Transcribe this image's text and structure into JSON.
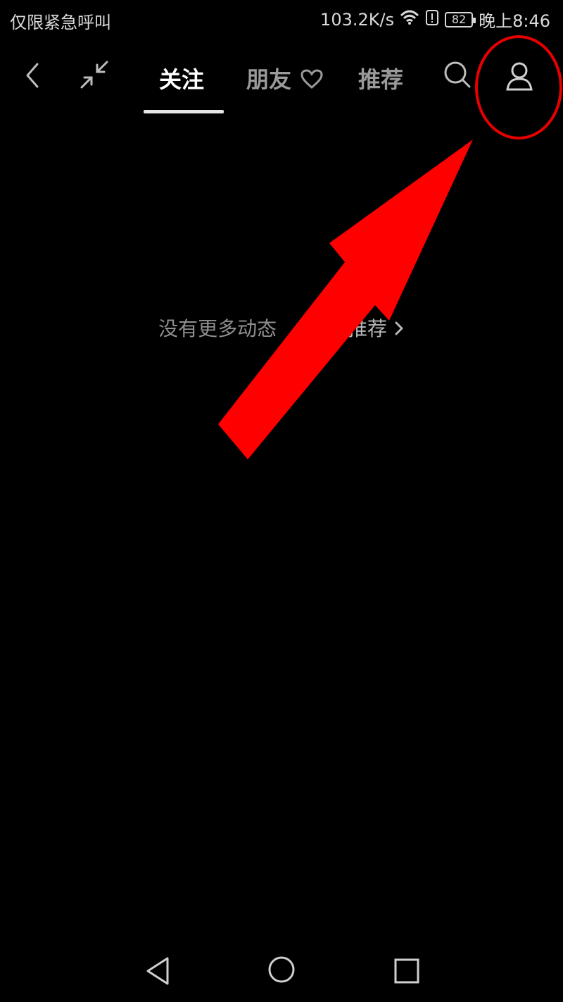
{
  "status_bar": {
    "carrier_text": "仅限紧急呼叫",
    "net_speed": "103.2K/s",
    "battery_level": "82",
    "time": "晚上8:46",
    "icons": [
      "wifi-icon",
      "alert-sim-icon",
      "battery-icon"
    ]
  },
  "top_nav": {
    "tabs": [
      {
        "label": "关注",
        "active": true
      },
      {
        "label": "朋友",
        "active": false
      },
      {
        "label": "推荐",
        "active": false
      }
    ],
    "icons": [
      "back-icon",
      "collapse-icon",
      "heart-icon",
      "search-icon",
      "profile-icon"
    ]
  },
  "empty_state": {
    "message": "没有更多动态",
    "link_text": "推荐",
    "link_icon": "chevron-right-icon"
  },
  "annotations": {
    "highlight_color": "#e60000",
    "arrow_color": "#ff0000",
    "highlight_target": "profile-icon"
  },
  "bottom_nav": {
    "icons": [
      "nav-back-icon",
      "nav-home-icon",
      "nav-recent-icon"
    ]
  }
}
